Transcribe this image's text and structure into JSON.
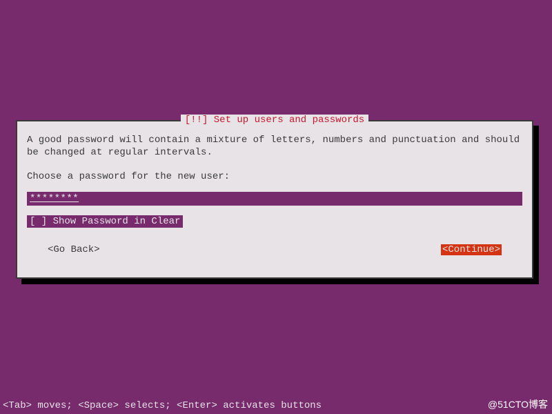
{
  "dialog": {
    "title": "[!!] Set up users and passwords",
    "help_text": "A good password will contain a mixture of letters, numbers and punctuation and should be changed at regular intervals.",
    "prompt": "Choose a password for the new user:",
    "password_value": "********",
    "checkbox_label": "[ ] Show Password in Clear",
    "go_back_label": "<Go Back>",
    "continue_label": "<Continue>"
  },
  "status_bar": "<Tab> moves; <Space> selects; <Enter> activates buttons",
  "watermark": "@51CTO博客"
}
